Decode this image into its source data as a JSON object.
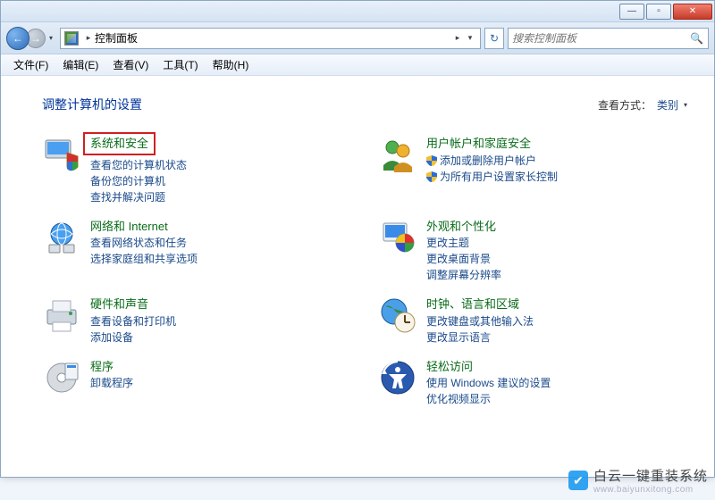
{
  "titlebar": {
    "min": "—",
    "max": "▫",
    "close": "✕"
  },
  "nav": {
    "back": "←",
    "fwd": "→",
    "drop": "▾"
  },
  "address": {
    "path": "控制面板",
    "sep": "▸",
    "drop": "▾",
    "refresh": "↻"
  },
  "search": {
    "placeholder": "搜索控制面板",
    "icon": "🔍"
  },
  "menu": {
    "file": "文件(F)",
    "edit": "编辑(E)",
    "view": "查看(V)",
    "tools": "工具(T)",
    "help": "帮助(H)"
  },
  "heading": "调整计算机的设置",
  "viewby": {
    "label": "查看方式：",
    "value": "类别",
    "tri": "▾"
  },
  "cats": {
    "system": {
      "title": "系统和安全",
      "links": [
        "查看您的计算机状态",
        "备份您的计算机",
        "查找并解决问题"
      ]
    },
    "users": {
      "title": "用户帐户和家庭安全",
      "links": [
        "添加或删除用户帐户",
        "为所有用户设置家长控制"
      ],
      "shielded": [
        0,
        1
      ]
    },
    "network": {
      "title": "网络和 Internet",
      "links": [
        "查看网络状态和任务",
        "选择家庭组和共享选项"
      ]
    },
    "appear": {
      "title": "外观和个性化",
      "links": [
        "更改主题",
        "更改桌面背景",
        "调整屏幕分辨率"
      ]
    },
    "hardware": {
      "title": "硬件和声音",
      "links": [
        "查看设备和打印机",
        "添加设备"
      ]
    },
    "clock": {
      "title": "时钟、语言和区域",
      "links": [
        "更改键盘或其他输入法",
        "更改显示语言"
      ]
    },
    "programs": {
      "title": "程序",
      "links": [
        "卸载程序"
      ]
    },
    "ease": {
      "title": "轻松访问",
      "links": [
        "使用 Windows 建议的设置",
        "优化视频显示"
      ]
    }
  },
  "watermark": {
    "cn": "白云一键重装系统",
    "url": "www.baiyunxitong.com"
  }
}
